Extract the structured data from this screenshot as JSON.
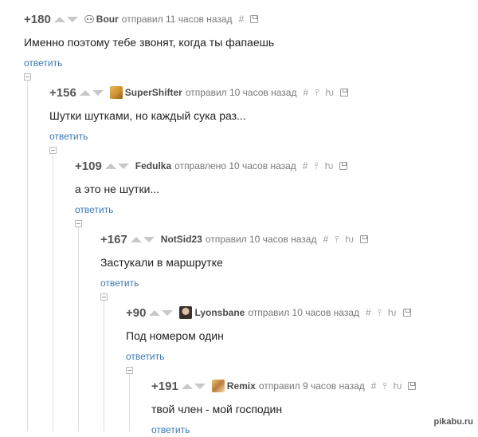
{
  "comments": [
    {
      "rating": "+180",
      "author": "Bour",
      "meta": "отправил 11 часов назад",
      "text": "Именно поэтому тебе звонят, когда ты фапаешь",
      "reply": "ответить"
    },
    {
      "rating": "+156",
      "author": "SuperShifter",
      "meta": "отправил 10 часов назад",
      "text": "Шутки шутками, но каждый сука раз...",
      "reply": "ответить"
    },
    {
      "rating": "+109",
      "author": "Fedulka",
      "meta": "отправлено 10 часов назад",
      "text": "а это не шутки...",
      "reply": "ответить"
    },
    {
      "rating": "+167",
      "author": "NotSid23",
      "meta": "отправил 10 часов назад",
      "text": "Застукали в маршрутке",
      "reply": "ответить"
    },
    {
      "rating": "+90",
      "author": "Lyonsbane",
      "meta": "отправил 10 часов назад",
      "text": "Под номером один",
      "reply": "ответить"
    },
    {
      "rating": "+191",
      "author": "Remix",
      "meta": "отправил 9 часов назад",
      "text": "твой член - мой господин",
      "reply": "ответить"
    }
  ],
  "icons": {
    "hash": "#",
    "pin": "⫯",
    "branch": "ƕ"
  },
  "watermark": "pikabu.ru"
}
